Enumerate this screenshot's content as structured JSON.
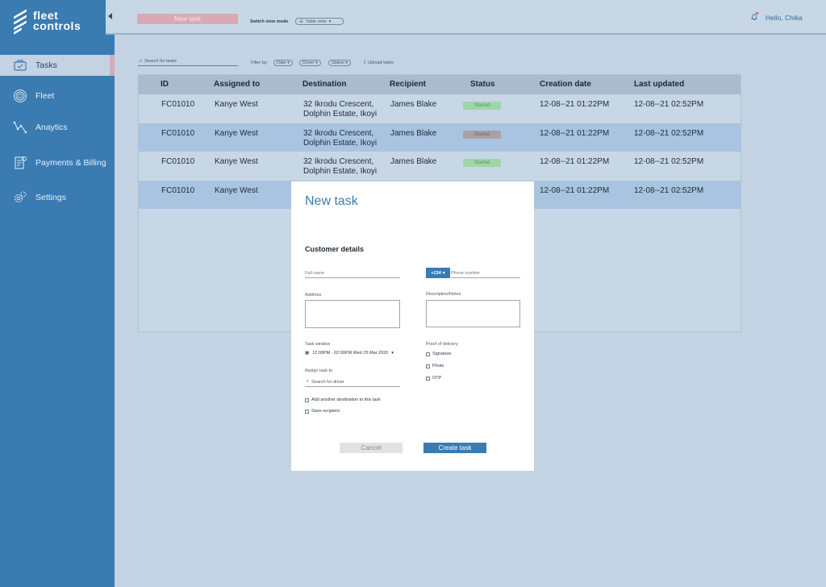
{
  "app": {
    "logo_line1": "fleet",
    "logo_line2": "controls"
  },
  "sidebar": {
    "items": [
      {
        "label": "Tasks",
        "icon": "tasks-icon",
        "active": true
      },
      {
        "label": "Fleet",
        "icon": "fleet-icon"
      },
      {
        "label": "Anaytics",
        "icon": "analytics-icon"
      },
      {
        "label": "Payments & Billing",
        "icon": "payments-icon"
      },
      {
        "label": "Settings",
        "icon": "settings-icon"
      }
    ]
  },
  "header": {
    "new_task_label": "New task",
    "switch_view_label": "Switch view mode",
    "view_mode": "Table view",
    "greeting": "Hello, Chika"
  },
  "filters": {
    "search_placeholder": "Search for tasks",
    "filter_by_label": "Filter by:",
    "date": "Date",
    "driver": "Driver",
    "status": "Status",
    "upload_label": "Upload tasks"
  },
  "table": {
    "headers": [
      "ID",
      "Assigned to",
      "Destination",
      "Recipient",
      "Status",
      "Creation date",
      "Last updated"
    ],
    "rows": [
      {
        "id": "FC01010",
        "assigned": "Kanye West",
        "dest1": "32 Ikrodu Crescent,",
        "dest2": "Dolphin Estate, Ikoyi",
        "recipient": "James Blake",
        "status": "Started",
        "created": "12-08--21 01:22PM",
        "updated": "12-08--21 02:52PM"
      },
      {
        "id": "FC01010",
        "assigned": "Kanye West",
        "dest1": "32 Ikrodu Crescent,",
        "dest2": "Dolphin Estate, Ikoyi",
        "recipient": "James Blake",
        "status": "Started",
        "created": "12-08--21 01:22PM",
        "updated": "12-08--21 02:52PM"
      },
      {
        "id": "FC01010",
        "assigned": "Kanye West",
        "dest1": "32 Ikrodu Crescent,",
        "dest2": "Dolphin Estate, Ikoyi",
        "recipient": "James Blake",
        "status": "Started",
        "created": "12-08--21 01:22PM",
        "updated": "12-08--21 02:52PM"
      },
      {
        "id": "FC01010",
        "assigned": "Kanye West",
        "created": "12-08--21 01:22PM",
        "updated": "12-08--21 02:52PM"
      }
    ]
  },
  "modal": {
    "title": "New task",
    "section": "Customer details",
    "full_name_placeholder": "Full name",
    "country_code": "+234",
    "phone_placeholder": "Phone number",
    "address_label": "Address",
    "notes_label": "Description/Notes",
    "task_window_label": "Task window",
    "task_window_value": "12:00PM - 02:00PM Wed 25 Mar 2020",
    "proof_label": "Proof of delivery",
    "proof_options": [
      "Signature",
      "Photo",
      "OTP"
    ],
    "assign_label": "Assign task to",
    "driver_search_placeholder": "Search for driver",
    "add_destination_label": "Add another destination to this task",
    "save_recipient_label": "Save recipient",
    "cancel_label": "Cancel",
    "create_label": "Create task"
  },
  "colors": {
    "primary": "#3a7bb1",
    "accent_pink": "#d9aab4",
    "status_green": "#9fd6a6"
  }
}
